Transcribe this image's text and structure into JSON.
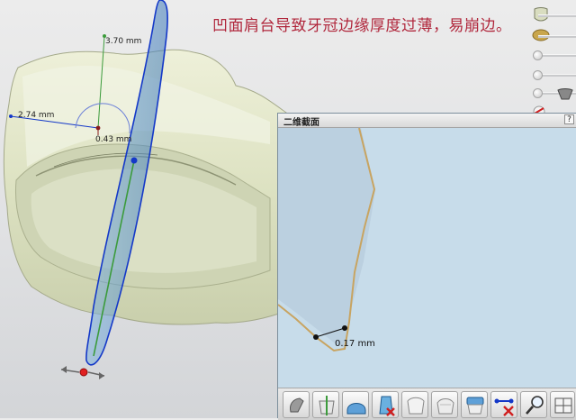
{
  "annotation": {
    "text": "凹面肩台导致牙冠边缘厚度过薄，易崩边。"
  },
  "viewport": {
    "measurements": {
      "height": "3.70 mm",
      "width": "2.74 mm",
      "offset": "0.43 mm"
    }
  },
  "section_panel": {
    "title": "二维截面",
    "help": "?",
    "measurement": "0.17 mm"
  },
  "toolbar": {
    "buttons": [
      {
        "icon": "gray-tooth-tool-icon"
      },
      {
        "icon": "tooth-cross-section-icon"
      },
      {
        "icon": "blue-crown-cap-icon"
      },
      {
        "icon": "tooth-delete-icon"
      },
      {
        "icon": "white-tooth-icon"
      },
      {
        "icon": "white-tooth-alt-icon"
      },
      {
        "icon": "blue-tooth-top-icon"
      },
      {
        "icon": "remove-measurement-icon"
      },
      {
        "icon": "magnifier-icon"
      },
      {
        "icon": "grid-view-icon"
      }
    ]
  },
  "colors": {
    "annotation": "#b0263b",
    "section_background": "#c7dcea",
    "crown_body": "#dfe4c6",
    "margin_line": "#c8a461",
    "axis_blue": "#1438c8",
    "axis_green": "#3b9b3b"
  }
}
